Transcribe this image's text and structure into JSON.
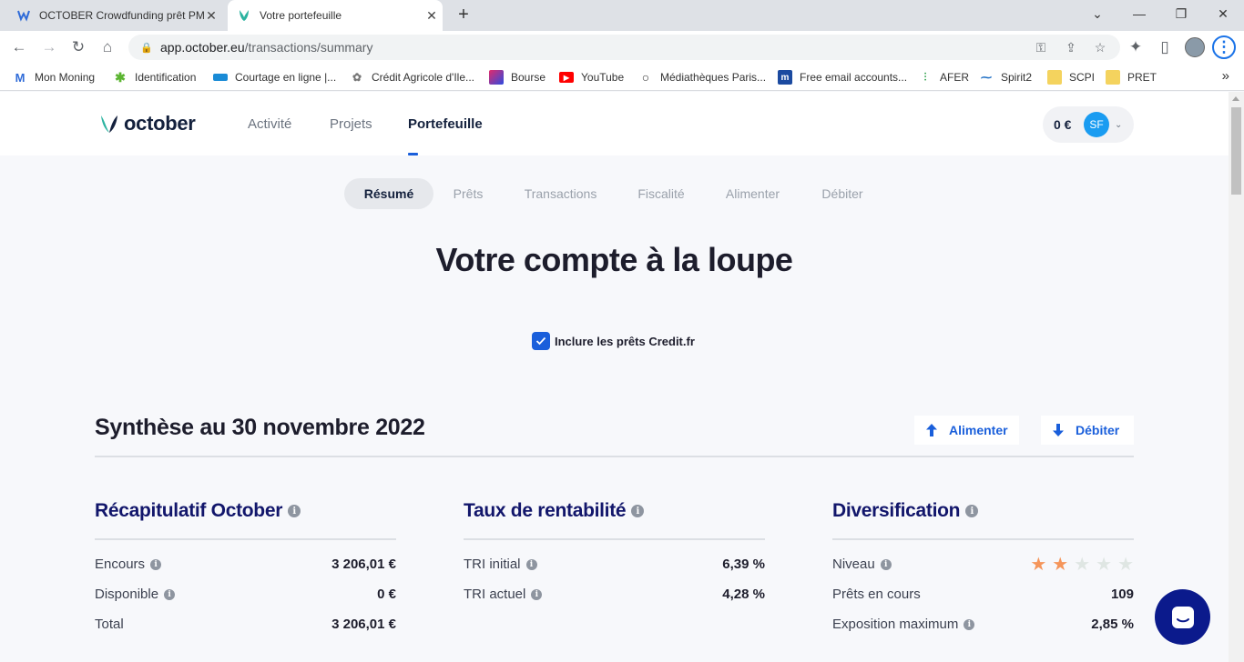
{
  "browser": {
    "tabs": [
      {
        "title": "OCTOBER Crowdfunding prêt PME",
        "active": false
      },
      {
        "title": "Votre portefeuille",
        "active": true
      }
    ],
    "url_host": "app.october.eu",
    "url_path": "/transactions/summary",
    "bookmarks": [
      {
        "label": "Mon Moning",
        "color": "#2f6bd8"
      },
      {
        "label": "Identification",
        "color": "#5bb531"
      },
      {
        "label": "Courtage en ligne |...",
        "color": "#1a8bd6"
      },
      {
        "label": "Crédit Agricole d'Ile...",
        "color": "#777777"
      },
      {
        "label": "Bourse",
        "color": "#e22b6b"
      },
      {
        "label": "YouTube",
        "color": "#ff0000"
      },
      {
        "label": "Médiathèques Paris...",
        "color": "#333333"
      },
      {
        "label": "Free email accounts...",
        "color": "#1b4aa0"
      },
      {
        "label": "AFER",
        "color": "#3aa655"
      },
      {
        "label": "Spirit2",
        "color": "#1f6fc5"
      },
      {
        "label": "SCPI",
        "color": "#f4d35e"
      },
      {
        "label": "PRET",
        "color": "#f4d35e"
      }
    ]
  },
  "header": {
    "brand": "october",
    "nav": [
      {
        "label": "Activité",
        "active": false
      },
      {
        "label": "Projets",
        "active": false
      },
      {
        "label": "Portefeuille",
        "active": true
      }
    ],
    "balance": "0 €",
    "avatar_initials": "SF"
  },
  "subtabs": [
    "Résumé",
    "Prêts",
    "Transactions",
    "Fiscalité",
    "Alimenter",
    "Débiter"
  ],
  "page_title": "Votre compte à la loupe",
  "include_credit_fr": {
    "label": "Inclure les prêts Credit.fr",
    "checked": true
  },
  "synthesis": {
    "title": "Synthèse au 30 novembre 2022",
    "fund_button": "Alimenter",
    "withdraw_button": "Débiter"
  },
  "recap": {
    "title": "Récapitulatif October",
    "rows": [
      {
        "label": "Encours",
        "value": "3 206,01 €",
        "info": true
      },
      {
        "label": "Disponible",
        "value": "0 €",
        "info": true
      },
      {
        "label": "Total",
        "value": "3 206,01 €",
        "info": false
      }
    ]
  },
  "rentabilite": {
    "title": "Taux de rentabilité",
    "rows": [
      {
        "label": "TRI initial",
        "value": "6,39 %",
        "info": true
      },
      {
        "label": "TRI actuel",
        "value": "4,28 %",
        "info": true
      }
    ]
  },
  "diversification": {
    "title": "Diversification",
    "level_label": "Niveau",
    "level_stars": 2,
    "level_max": 5,
    "rows": [
      {
        "label": "Prêts en cours",
        "value": "109",
        "info": false
      },
      {
        "label": "Exposition maximum",
        "value": "2,85 %",
        "info": true
      }
    ]
  },
  "colors": {
    "accent": "#1a5fdb",
    "title_navy": "#12166b",
    "star_on": "#f5955a",
    "star_off": "#dfe6e3",
    "chat": "#0b1a8c"
  }
}
